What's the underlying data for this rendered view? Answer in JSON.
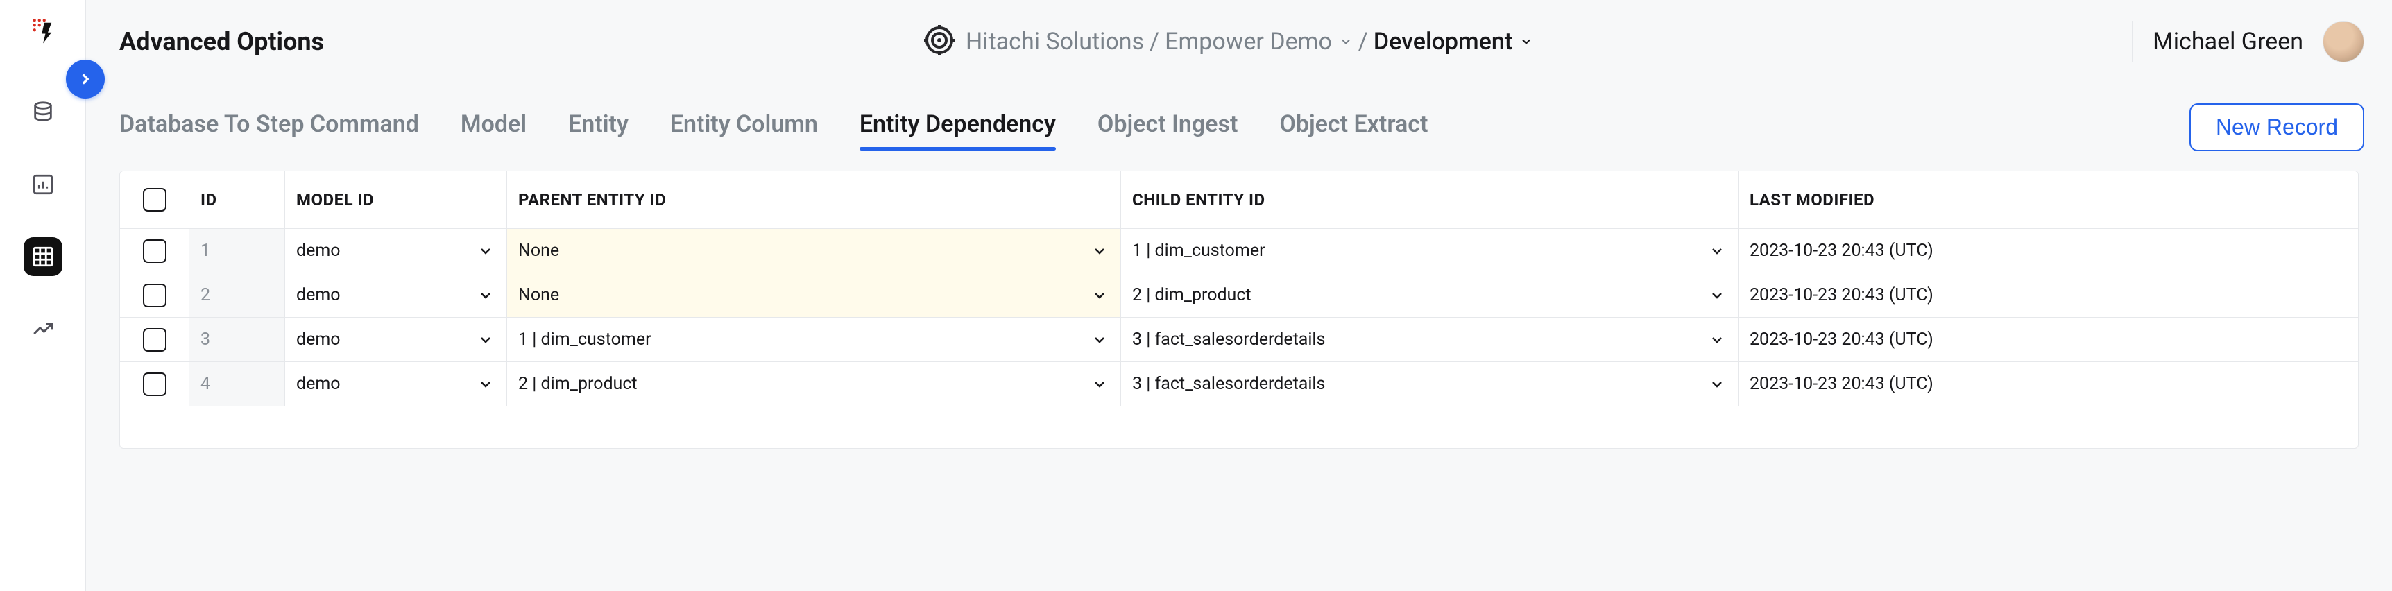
{
  "header": {
    "page_title": "Advanced Options",
    "breadcrumb": {
      "org": "Hitachi Solutions",
      "project": "Empower Demo",
      "env": "Development"
    },
    "user_name": "Michael Green"
  },
  "tabs": {
    "items": [
      {
        "label": "Database To Step Command",
        "active": false
      },
      {
        "label": "Model",
        "active": false
      },
      {
        "label": "Entity",
        "active": false
      },
      {
        "label": "Entity Column",
        "active": false
      },
      {
        "label": "Entity Dependency",
        "active": true
      },
      {
        "label": "Object Ingest",
        "active": false
      },
      {
        "label": "Object Extract",
        "active": false
      }
    ],
    "new_record_label": "New Record"
  },
  "table": {
    "columns": {
      "id": "ID",
      "model_id": "MODEL ID",
      "parent_entity_id": "PARENT ENTITY ID",
      "child_entity_id": "CHILD ENTITY ID",
      "last_modified": "LAST MODIFIED"
    },
    "rows": [
      {
        "id": "1",
        "model_id": "demo",
        "parent_entity_id": "None",
        "parent_none": true,
        "child_entity_id": "1 | dim_customer",
        "last_modified": "2023-10-23 20:43 (UTC)"
      },
      {
        "id": "2",
        "model_id": "demo",
        "parent_entity_id": "None",
        "parent_none": true,
        "child_entity_id": "2 | dim_product",
        "last_modified": "2023-10-23 20:43 (UTC)"
      },
      {
        "id": "3",
        "model_id": "demo",
        "parent_entity_id": "1 | dim_customer",
        "parent_none": false,
        "child_entity_id": "3 | fact_salesorderdetails",
        "last_modified": "2023-10-23 20:43 (UTC)"
      },
      {
        "id": "4",
        "model_id": "demo",
        "parent_entity_id": "2 | dim_product",
        "parent_none": false,
        "child_entity_id": "3 | fact_salesorderdetails",
        "last_modified": "2023-10-23 20:43 (UTC)"
      }
    ]
  }
}
